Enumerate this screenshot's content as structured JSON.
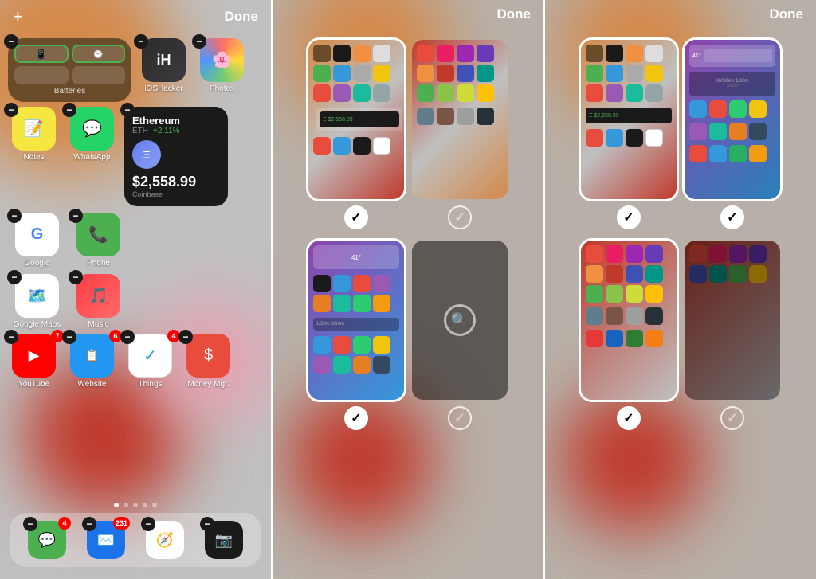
{
  "panel1": {
    "top_bar": {
      "add_label": "+",
      "done_label": "Done"
    },
    "widgets": {
      "batteries_label": "Batteries",
      "eth_title": "Ethereum",
      "eth_sub": "ETH",
      "eth_change": "+2.11%",
      "eth_price": "$2,558.99",
      "eth_widget_label": "Coinbase"
    },
    "apps": {
      "row1": [
        {
          "name": "iOSHacker",
          "icon": "iH",
          "color": "ioshacker"
        },
        {
          "name": "Photos",
          "icon": "🌸",
          "color": "photos"
        }
      ],
      "row2": [
        {
          "name": "Notes",
          "icon": "📝",
          "color": "notes"
        },
        {
          "name": "WhatsApp",
          "icon": "💬",
          "color": "whatsapp"
        }
      ],
      "row3": [
        {
          "name": "Google",
          "icon": "G",
          "color": "google"
        },
        {
          "name": "Phone",
          "icon": "📞",
          "color": "phone"
        }
      ],
      "row4": [
        {
          "name": "Google Maps",
          "icon": "📍",
          "color": "maps"
        },
        {
          "name": "Music",
          "icon": "♪",
          "color": "music"
        }
      ],
      "row5": [
        {
          "name": "YouTube",
          "icon": "▶",
          "color": "youtube",
          "badge": "7"
        },
        {
          "name": "Website",
          "icon": "📋",
          "color": "website",
          "badge": "6"
        },
        {
          "name": "Things",
          "icon": "✓",
          "color": "things",
          "badge": "4"
        },
        {
          "name": "Money Mgr.",
          "icon": "$",
          "color": "money"
        }
      ]
    },
    "dock": [
      "Messages",
      "Mail",
      "Safari",
      "Camera"
    ],
    "page_dots": 5,
    "active_dot": 1
  },
  "panel2": {
    "done_label": "Done",
    "pages": [
      {
        "selected": true,
        "check": "checked"
      },
      {
        "selected": false,
        "check": "unchecked"
      },
      {
        "selected": true,
        "check": "checked"
      },
      {
        "selected": false,
        "check": "unchecked"
      }
    ]
  },
  "panel3": {
    "done_label": "Done",
    "pages": [
      {
        "selected": true,
        "check": "checked"
      },
      {
        "selected": false,
        "check": "checked"
      },
      {
        "selected": false,
        "check": "unchecked",
        "dimmed": true
      }
    ]
  }
}
